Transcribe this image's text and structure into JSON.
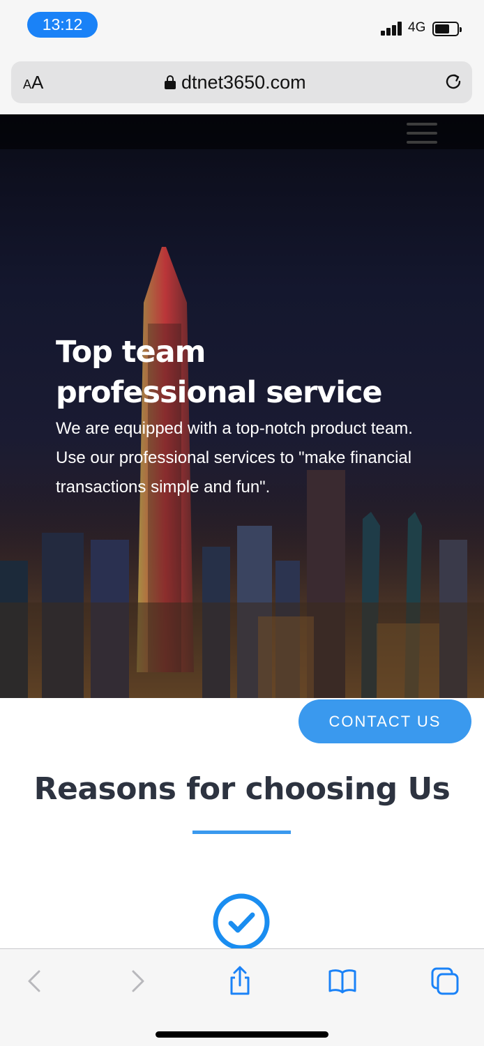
{
  "status_bar": {
    "time": "13:12",
    "network": "4G",
    "accent_color": "#1a82f7"
  },
  "browser": {
    "text_size_label": "AA",
    "url": "dtnet3650.com",
    "icons": [
      "lock-icon",
      "reload-icon"
    ]
  },
  "hero": {
    "title_line1": "Top team",
    "title_line2": "professional service",
    "description_line1": "We are equipped with a top-notch product team.",
    "description_line2": "Use our professional services to \"make financial transactions simple and fun\".",
    "menu_icon": "hamburger-menu-icon"
  },
  "content": {
    "contact_label": "CONTACT US",
    "section_title": "Reasons for choosing Us",
    "accent_color": "#3a99ee",
    "title_color": "#2d3340",
    "check_icon": "checkmark-circle-icon"
  },
  "toolbar": {
    "icons": [
      "back-icon",
      "forward-icon",
      "share-icon",
      "bookmarks-icon",
      "tabs-icon"
    ],
    "icon_color": "#1a82f7"
  }
}
